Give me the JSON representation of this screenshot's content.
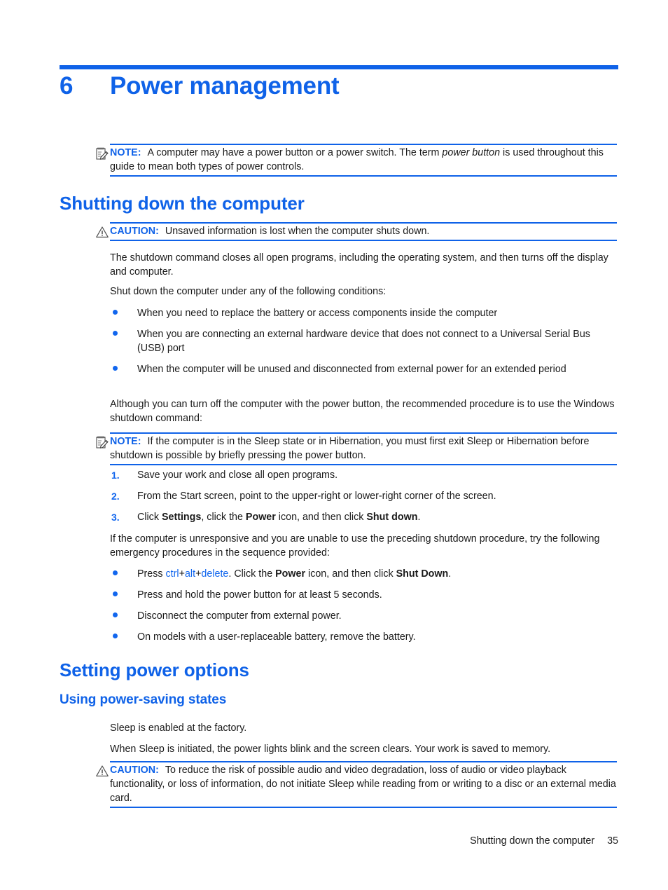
{
  "chapter": {
    "number": "6",
    "title": "Power management",
    "accent_color": "#0f62e8"
  },
  "note_1": {
    "icon": "note-pad-pencil-icon",
    "tag": "NOTE:",
    "text_before": "A computer may have a power button or a power switch. The term ",
    "italic": "power button",
    "text_after": " is used throughout this guide to mean both types of power controls."
  },
  "heading_1": "Shutting down the computer",
  "caution_1": {
    "icon": "warning-triangle-icon",
    "tag": "CAUTION:",
    "text": "Unsaved information is lost when the computer shuts down."
  },
  "para_1": "The shutdown command closes all open programs, including the operating system, and then turns off the display and computer.",
  "para_2": "Shut down the computer under any of the following conditions:",
  "bullets_1": [
    "When you need to replace the battery or access components inside the computer",
    "When you are connecting an external hardware device that does not connect to a Universal Serial Bus (USB) port",
    "When the computer will be unused and disconnected from external power for an extended period"
  ],
  "para_3": "Although you can turn off the computer with the power button, the recommended procedure is to use the Windows shutdown command:",
  "note_2": {
    "icon": "note-pad-pencil-icon",
    "tag": "NOTE:",
    "text": "If the computer is in the Sleep state or in Hibernation, you must first exit Sleep or Hibernation before shutdown is possible by briefly pressing the power button."
  },
  "steps": [
    {
      "num": "1.",
      "text": "Save your work and close all open programs."
    },
    {
      "num": "2.",
      "text": "From the Start screen, point to the upper-right or lower-right corner of the screen."
    },
    {
      "num": "3.",
      "parts": [
        {
          "t": "Click ",
          "style": "plain"
        },
        {
          "t": "Settings",
          "style": "bold"
        },
        {
          "t": ", click the ",
          "style": "plain"
        },
        {
          "t": "Power",
          "style": "bold"
        },
        {
          "t": " icon, and then click ",
          "style": "plain"
        },
        {
          "t": "Shut down",
          "style": "bold"
        },
        {
          "t": ".",
          "style": "plain"
        }
      ]
    }
  ],
  "para_4": "If the computer is unresponsive and you are unable to use the preceding shutdown procedure, try the following emergency procedures in the sequence provided:",
  "bullets_2": {
    "item_1_parts": [
      {
        "t": "Press ",
        "style": "plain"
      },
      {
        "t": "ctrl",
        "style": "key"
      },
      {
        "t": "+",
        "style": "plain"
      },
      {
        "t": "alt",
        "style": "key"
      },
      {
        "t": "+",
        "style": "plain"
      },
      {
        "t": "delete",
        "style": "key"
      },
      {
        "t": ". Click the ",
        "style": "plain"
      },
      {
        "t": "Power",
        "style": "bold"
      },
      {
        "t": " icon, and then click ",
        "style": "plain"
      },
      {
        "t": "Shut Down",
        "style": "bold"
      },
      {
        "t": ".",
        "style": "plain"
      }
    ],
    "item_2": "Press and hold the power button for at least 5 seconds.",
    "item_3": "Disconnect the computer from external power.",
    "item_4": "On models with a user-replaceable battery, remove the battery."
  },
  "heading_2": "Setting power options",
  "heading_3": "Using power-saving states",
  "para_5": "Sleep is enabled at the factory.",
  "para_6": "When Sleep is initiated, the power lights blink and the screen clears. Your work is saved to memory.",
  "caution_2": {
    "icon": "warning-triangle-icon",
    "tag": "CAUTION:",
    "text": "To reduce the risk of possible audio and video degradation, loss of audio or video playback functionality, or loss of information, do not initiate Sleep while reading from or writing to a disc or an external media card."
  },
  "footer": {
    "section": "Shutting down the computer",
    "page": "35"
  }
}
